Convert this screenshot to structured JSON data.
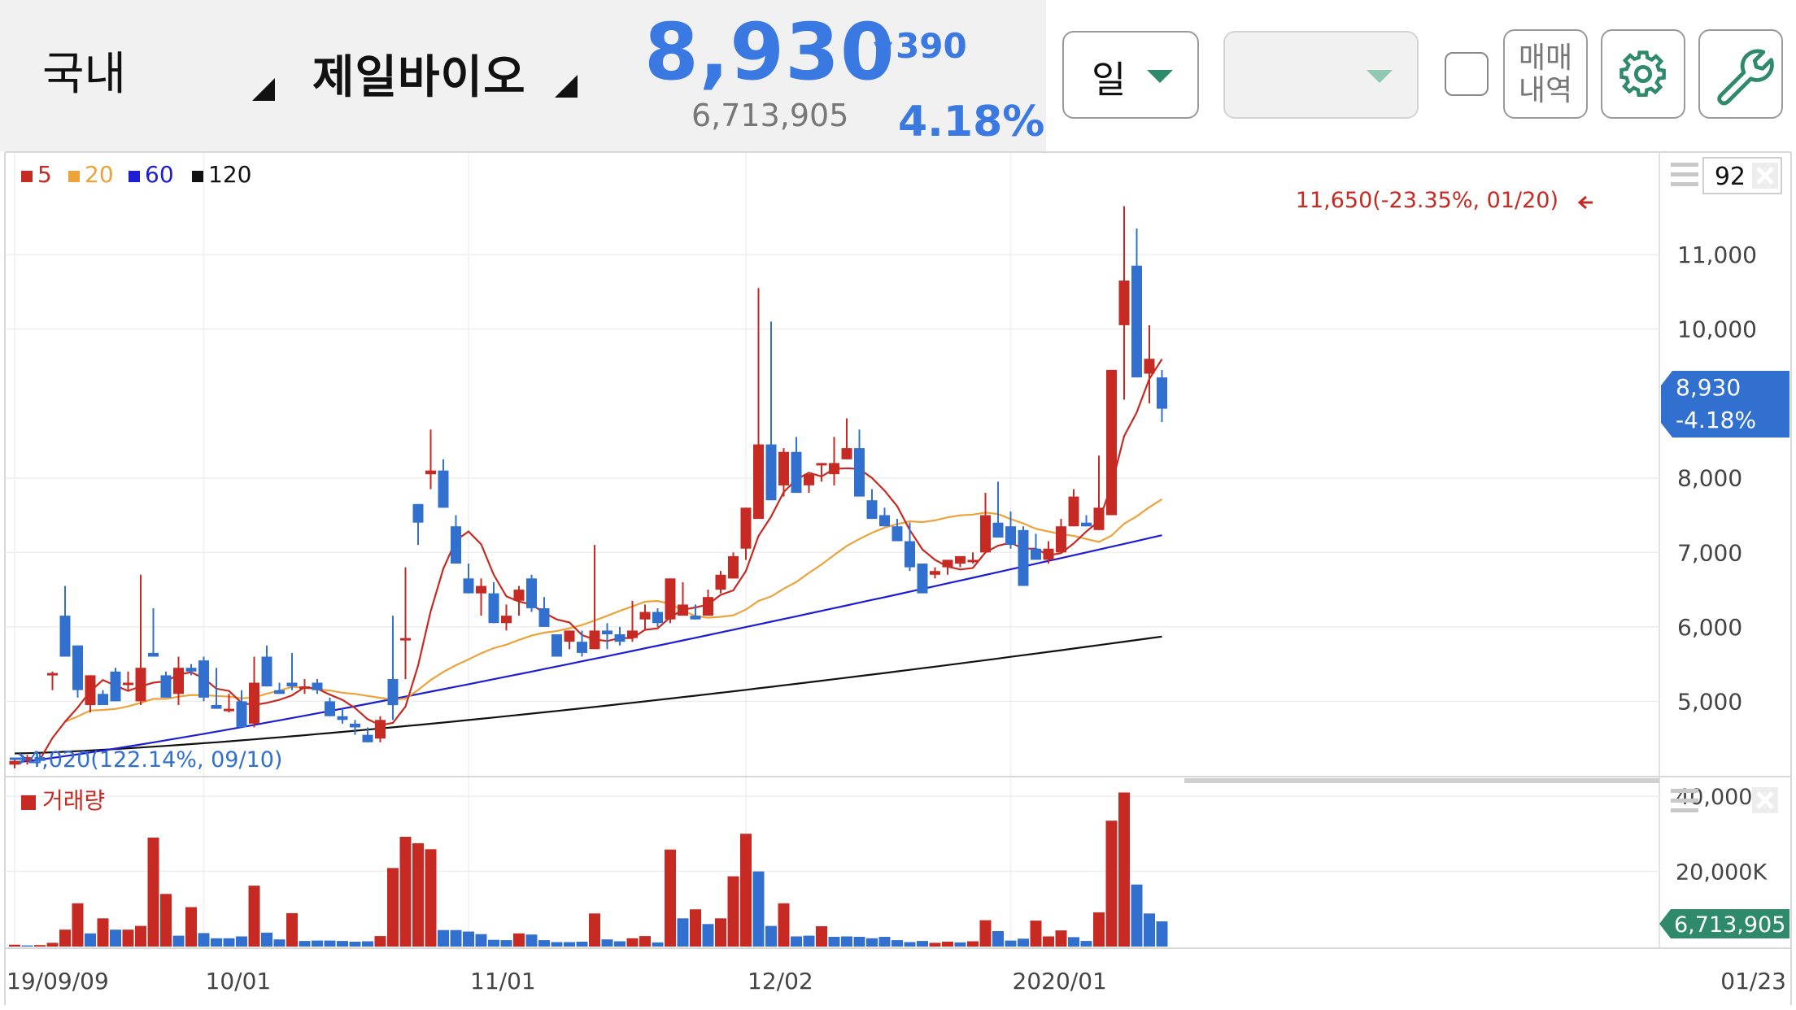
{
  "header": {
    "market": "국내",
    "stock_name": "제일바이오",
    "price": "8,930",
    "change_arrow": "▼",
    "change": "390",
    "volume": "6,713,905",
    "change_pct": "4.18%"
  },
  "toolbar": {
    "period_label": "일",
    "combo_value": "",
    "history_line1": "매매",
    "history_line2": "내역",
    "zoom_value": "92"
  },
  "colors": {
    "up": "#c62a22",
    "down": "#3270cf",
    "ma5": "#c62a22",
    "ma20": "#eda23a",
    "ma60": "#1d1dd6",
    "ma120": "#111111",
    "accent_blue": "#3a78e2",
    "accent_green": "#2e8a6a"
  },
  "icons": {
    "settings": "gear-icon",
    "tools": "wrench-icon",
    "menu": "hamburger-icon",
    "close": "close-icon"
  },
  "chart_data": {
    "type": "candlestick",
    "legend": [
      {
        "label": "5",
        "color": "#c62a22"
      },
      {
        "label": "20",
        "color": "#eda23a"
      },
      {
        "label": "60",
        "color": "#1d1dd6"
      },
      {
        "label": "120",
        "color": "#111111"
      }
    ],
    "price_ticks": [
      "11,000",
      "10,000",
      "8,000",
      "7,000",
      "6,000",
      "5,000"
    ],
    "price_tick_values": [
      11000,
      10000,
      8000,
      7000,
      6000,
      5000
    ],
    "ylim": [
      4000,
      11950
    ],
    "high_annotation": "11,650(-23.35%, 01/20)",
    "high_value": 11650,
    "low_annotation": "4,020(122.14%, 09/10)",
    "low_value": 4020,
    "current_price_label": "8,930",
    "current_pct_label": "-4.18%",
    "current_value": 8930,
    "x_labels": [
      "19/09/09",
      "10/01",
      "11/01",
      "12/02",
      "2020/01",
      "01/23"
    ],
    "x_label_index": [
      0,
      15,
      36,
      58,
      79,
      96
    ],
    "volume_title": "거래량",
    "volume_ticks": [
      "40,000K",
      "20,000K"
    ],
    "volume_tick_values": [
      40000,
      20000
    ],
    "volume_current_label": "6,713,905",
    "ohlc": [
      [
        4150,
        4230,
        4100,
        4200
      ],
      [
        4200,
        4280,
        4150,
        4250
      ],
      [
        4250,
        4300,
        4180,
        4200
      ],
      [
        5350,
        5400,
        5150,
        5380
      ],
      [
        6150,
        6550,
        5650,
        5600
      ],
      [
        5750,
        5750,
        5050,
        5150
      ],
      [
        4950,
        5350,
        4850,
        5350
      ],
      [
        5100,
        5150,
        4950,
        4950
      ],
      [
        5400,
        5450,
        5050,
        5000
      ],
      [
        5250,
        5400,
        5150,
        5250
      ],
      [
        5000,
        6700,
        4950,
        5450
      ],
      [
        5650,
        6250,
        5600,
        5600
      ],
      [
        5350,
        5400,
        5050,
        5050
      ],
      [
        5100,
        5600,
        4950,
        5450
      ],
      [
        5450,
        5500,
        5350,
        5400
      ],
      [
        5550,
        5600,
        5000,
        5050
      ],
      [
        4950,
        5450,
        4950,
        4900
      ],
      [
        4900,
        5100,
        4850,
        4900
      ],
      [
        5000,
        5150,
        4650,
        4650
      ],
      [
        4700,
        5600,
        4650,
        5250
      ],
      [
        5600,
        5750,
        5350,
        5200
      ],
      [
        5150,
        5250,
        5100,
        5100
      ],
      [
        5250,
        5650,
        5150,
        5200
      ],
      [
        5200,
        5300,
        5100,
        5200
      ],
      [
        5250,
        5300,
        5100,
        5150
      ],
      [
        5000,
        5050,
        4800,
        4800
      ],
      [
        4800,
        4900,
        4700,
        4750
      ],
      [
        4700,
        4750,
        4550,
        4650
      ],
      [
        4550,
        4650,
        4450,
        4450
      ],
      [
        4500,
        4800,
        4450,
        4750
      ],
      [
        5300,
        6150,
        4750,
        4950
      ],
      [
        5850,
        6800,
        5300,
        5850
      ],
      [
        7650,
        7600,
        7100,
        7400
      ],
      [
        8050,
        8650,
        7850,
        8100
      ],
      [
        8100,
        8250,
        7750,
        7600
      ],
      [
        7350,
        7500,
        6850,
        6850
      ],
      [
        6650,
        6850,
        6500,
        6450
      ],
      [
        6450,
        6650,
        6150,
        6550
      ],
      [
        6450,
        6600,
        6050,
        6050
      ],
      [
        6050,
        6300,
        5950,
        6150
      ],
      [
        6350,
        6550,
        6150,
        6500
      ],
      [
        6650,
        6700,
        6200,
        6250
      ],
      [
        6250,
        6400,
        6050,
        6000
      ],
      [
        5900,
        5900,
        5600,
        5600
      ],
      [
        5800,
        5850,
        5700,
        5950
      ],
      [
        5800,
        5950,
        5600,
        5650
      ],
      [
        5700,
        7100,
        5700,
        5950
      ],
      [
        5950,
        6050,
        5700,
        5900
      ],
      [
        5900,
        6000,
        5750,
        5800
      ],
      [
        5850,
        6350,
        5800,
        5950
      ],
      [
        6100,
        6300,
        5950,
        6200
      ],
      [
        6200,
        6250,
        6000,
        6050
      ],
      [
        6100,
        6350,
        6050,
        6650
      ],
      [
        6150,
        6600,
        6150,
        6300
      ],
      [
        6150,
        6300,
        6100,
        6100
      ],
      [
        6150,
        6500,
        6150,
        6400
      ],
      [
        6500,
        6750,
        6450,
        6700
      ],
      [
        6650,
        7000,
        6650,
        6950
      ],
      [
        7050,
        7250,
        6900,
        7600
      ],
      [
        7450,
        10550,
        7450,
        8450
      ],
      [
        8450,
        10100,
        7700,
        7700
      ],
      [
        7900,
        8400,
        7750,
        8350
      ],
      [
        8350,
        8550,
        7800,
        7800
      ],
      [
        7900,
        7950,
        7800,
        8050
      ],
      [
        8200,
        7750,
        7950,
        8200
      ],
      [
        8050,
        8550,
        7900,
        8200
      ],
      [
        8250,
        8800,
        8250,
        8400
      ],
      [
        8400,
        8650,
        7750,
        7750
      ],
      [
        7700,
        7850,
        7450,
        7450
      ],
      [
        7500,
        7600,
        7400,
        7350
      ],
      [
        7350,
        7450,
        7150,
        7150
      ],
      [
        7150,
        7400,
        6750,
        6800
      ],
      [
        6850,
        6800,
        6650,
        6450
      ],
      [
        6700,
        6800,
        6650,
        6750
      ],
      [
        6800,
        6850,
        6700,
        6900
      ],
      [
        6850,
        6900,
        6800,
        6950
      ],
      [
        6900,
        7000,
        6850,
        6900
      ],
      [
        7000,
        7800,
        7000,
        7500
      ],
      [
        7400,
        7950,
        7300,
        7200
      ],
      [
        7350,
        7550,
        7050,
        7100
      ],
      [
        7300,
        7350,
        6800,
        6550
      ],
      [
        7050,
        7250,
        6950,
        6900
      ],
      [
        6900,
        7150,
        6850,
        7050
      ],
      [
        7000,
        7450,
        7000,
        7350
      ],
      [
        7350,
        7850,
        7350,
        7750
      ],
      [
        7400,
        7500,
        7350,
        7350
      ],
      [
        7300,
        8300,
        7350,
        7600
      ],
      [
        7500,
        9250,
        7650,
        9450
      ],
      [
        10050,
        11650,
        9050,
        10650
      ],
      [
        10850,
        11350,
        9800,
        9350
      ],
      [
        9400,
        10050,
        9000,
        9600
      ],
      [
        9350,
        9450,
        8750,
        8930
      ]
    ],
    "volume": [
      [
        500,
        "up"
      ],
      [
        300,
        "down"
      ],
      [
        400,
        "up"
      ],
      [
        1000,
        "up"
      ],
      [
        4500,
        "up"
      ],
      [
        11500,
        "up"
      ],
      [
        3500,
        "down"
      ],
      [
        7500,
        "up"
      ],
      [
        4500,
        "down"
      ],
      [
        4500,
        "up"
      ],
      [
        5500,
        "up"
      ],
      [
        29000,
        "up"
      ],
      [
        14000,
        "up"
      ],
      [
        2900,
        "down"
      ],
      [
        10500,
        "up"
      ],
      [
        3600,
        "down"
      ],
      [
        2200,
        "down"
      ],
      [
        2200,
        "down"
      ],
      [
        2700,
        "down"
      ],
      [
        16200,
        "up"
      ],
      [
        3700,
        "down"
      ],
      [
        1900,
        "down"
      ],
      [
        8900,
        "up"
      ],
      [
        1500,
        "down"
      ],
      [
        1600,
        "down"
      ],
      [
        1600,
        "down"
      ],
      [
        1500,
        "down"
      ],
      [
        1300,
        "down"
      ],
      [
        1400,
        "down"
      ],
      [
        2800,
        "up"
      ],
      [
        20900,
        "up"
      ],
      [
        29200,
        "up"
      ],
      [
        27500,
        "up"
      ],
      [
        25900,
        "up"
      ],
      [
        4400,
        "down"
      ],
      [
        4400,
        "down"
      ],
      [
        4000,
        "down"
      ],
      [
        3300,
        "down"
      ],
      [
        1800,
        "down"
      ],
      [
        1700,
        "down"
      ],
      [
        3500,
        "up"
      ],
      [
        3200,
        "down"
      ],
      [
        1700,
        "down"
      ],
      [
        1200,
        "down"
      ],
      [
        1200,
        "down"
      ],
      [
        1300,
        "down"
      ],
      [
        8800,
        "up"
      ],
      [
        1900,
        "down"
      ],
      [
        1400,
        "down"
      ],
      [
        2200,
        "up"
      ],
      [
        2800,
        "up"
      ],
      [
        1100,
        "down"
      ],
      [
        25800,
        "up"
      ],
      [
        7500,
        "down"
      ],
      [
        9900,
        "up"
      ],
      [
        6000,
        "down"
      ],
      [
        7500,
        "up"
      ],
      [
        18700,
        "up"
      ],
      [
        30000,
        "up"
      ],
      [
        20000,
        "down"
      ],
      [
        5500,
        "down"
      ],
      [
        11500,
        "up"
      ],
      [
        2700,
        "down"
      ],
      [
        2900,
        "down"
      ],
      [
        5400,
        "up"
      ],
      [
        2600,
        "down"
      ],
      [
        2700,
        "down"
      ],
      [
        2600,
        "down"
      ],
      [
        2200,
        "down"
      ],
      [
        2600,
        "down"
      ],
      [
        1700,
        "down"
      ],
      [
        1200,
        "down"
      ],
      [
        1500,
        "down"
      ],
      [
        1000,
        "up"
      ],
      [
        1300,
        "up"
      ],
      [
        1100,
        "down"
      ],
      [
        1400,
        "up"
      ],
      [
        7000,
        "up"
      ],
      [
        4100,
        "down"
      ],
      [
        1600,
        "down"
      ],
      [
        2100,
        "down"
      ],
      [
        6900,
        "up"
      ],
      [
        2700,
        "up"
      ],
      [
        4300,
        "up"
      ],
      [
        2500,
        "down"
      ],
      [
        1500,
        "down"
      ],
      [
        9100,
        "up"
      ],
      [
        33500,
        "up"
      ],
      [
        41000,
        "up"
      ],
      [
        16500,
        "down"
      ],
      [
        8800,
        "down"
      ],
      [
        6700,
        "down"
      ]
    ]
  }
}
